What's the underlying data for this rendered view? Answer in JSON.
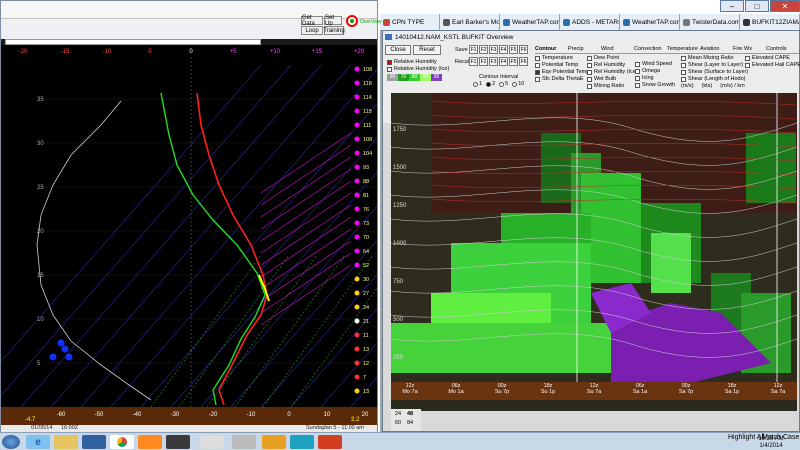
{
  "browser_tabs": [
    {
      "label": "CPN TYPE",
      "color": "#c8443c"
    },
    {
      "label": "Earl Barker's Modi...",
      "color": "#555555"
    },
    {
      "label": "WeatherTAP.com ...",
      "color": "#2a6fb0"
    },
    {
      "label": "ADDS - METARs",
      "color": "#2a6fb0"
    },
    {
      "label": "WeatherTAP.com ...",
      "color": "#2a6fb0"
    },
    {
      "label": "TwisterData.com ...",
      "color": "#777777"
    },
    {
      "label": "BUFKIT12ZIAMAN...",
      "color": "#333333"
    }
  ],
  "sounding": {
    "toolbar": {
      "get_data": "Get Data",
      "set_up": "Set Up",
      "loop": "Loop",
      "training": "Training",
      "logo_label": "OverView"
    },
    "temp_ticks": [
      "-20",
      "-15",
      "-10",
      "-5",
      "0",
      "+5",
      "+10",
      "+15",
      "+20"
    ],
    "height_labels": [
      "35",
      "30",
      "25",
      "20",
      "15",
      "10",
      "5"
    ],
    "bottom_temps": [
      "-60",
      "-50",
      "-40",
      "-30",
      "-20",
      "-10",
      "0",
      "10",
      "20",
      "30"
    ],
    "bottom_left": "-4.7",
    "bottom_right": "3.2",
    "right_labels": [
      "108",
      "118",
      "114",
      "115",
      "111",
      "108",
      "104",
      "93",
      "88",
      "81",
      "76",
      "73",
      "70",
      "64",
      "52",
      "30",
      "27",
      "24",
      "21",
      "11",
      "13",
      "12",
      "7",
      "13"
    ],
    "status": {
      "left": "01/05/14",
      "time": "16:00Z",
      "right": "Sunday",
      "right2": "Jan 5 - 11:00 am"
    }
  },
  "bufkit": {
    "title": "14010412.NAM_KSTL BUFKIT Overview",
    "buttons": {
      "close": "Close",
      "reset": "Reset",
      "save": "Save",
      "recall": "Recall"
    },
    "f_keys": [
      "F1",
      "F2",
      "F3",
      "F4",
      "F5",
      "F6"
    ],
    "checks_left": [
      "Relative Humidity",
      "Relative Humidity (Ice)"
    ],
    "contour": {
      "header": "Contour",
      "items": [
        "Temperature",
        "Potential Temp",
        "Eqv Potential Temp",
        "Sfc Delta ThetaE"
      ]
    },
    "contour_interval": {
      "label": "Contour Interval",
      "options": [
        "1",
        "2",
        "5",
        "10"
      ]
    },
    "precip": {
      "header": "Precip",
      "items": [
        "Dew Point",
        "Rel Humidity",
        "Rel Humidity (Ice)",
        "Wet Bulb",
        "Mixing Ratio"
      ]
    },
    "wind": {
      "header": "Wind",
      "items": [
        "Wind Speed",
        "Omega",
        "Icing",
        "Snow Growth"
      ]
    },
    "convection": {
      "header": "Convection",
      "items": []
    },
    "temperature": {
      "header": "Temperature",
      "items": []
    },
    "aviation": {
      "header": "Aviation",
      "items": [
        "Mean Mixing Ratio",
        "Shear (Layer to Layer)",
        "Shear (Surface to Layer)",
        "Shear (Length of Hodo)"
      ]
    },
    "fire": {
      "header": "Fire Wx",
      "items": [
        "Elevated CAPE",
        "Elevated Hail CAPE"
      ]
    },
    "controls": {
      "header": "Controls",
      "items": []
    },
    "units": [
      "(m/s)",
      "(kts)",
      "(m/s) / km"
    ],
    "rh_colors": [
      "30",
      "70",
      "80",
      "90",
      "95"
    ],
    "y_ticks": [
      "1750",
      "1500",
      "1250",
      "1000",
      "750",
      "500",
      "250"
    ],
    "x_ticks": [
      {
        "t": "12z",
        "d": "Mo 7a"
      },
      {
        "t": "06z",
        "d": "Mo 1a"
      },
      {
        "t": "00z",
        "d": "Su 7p"
      },
      {
        "t": "18z",
        "d": "Su 1p"
      },
      {
        "t": "12z",
        "d": "Su 7a"
      },
      {
        "t": "06z",
        "d": "Sa 1a"
      },
      {
        "t": "00z",
        "d": "Sa 7p"
      },
      {
        "t": "18z",
        "d": "Sa 1p"
      },
      {
        "t": "12z",
        "d": "Sa 7a"
      }
    ],
    "corner": {
      "a": "24",
      "b": "48",
      "c": "60",
      "d": "84"
    }
  },
  "taskbar": {
    "highlight": "Highlight All",
    "match_case": "Match Case",
    "time": "10:36 AM",
    "date": "1/4/2014"
  }
}
